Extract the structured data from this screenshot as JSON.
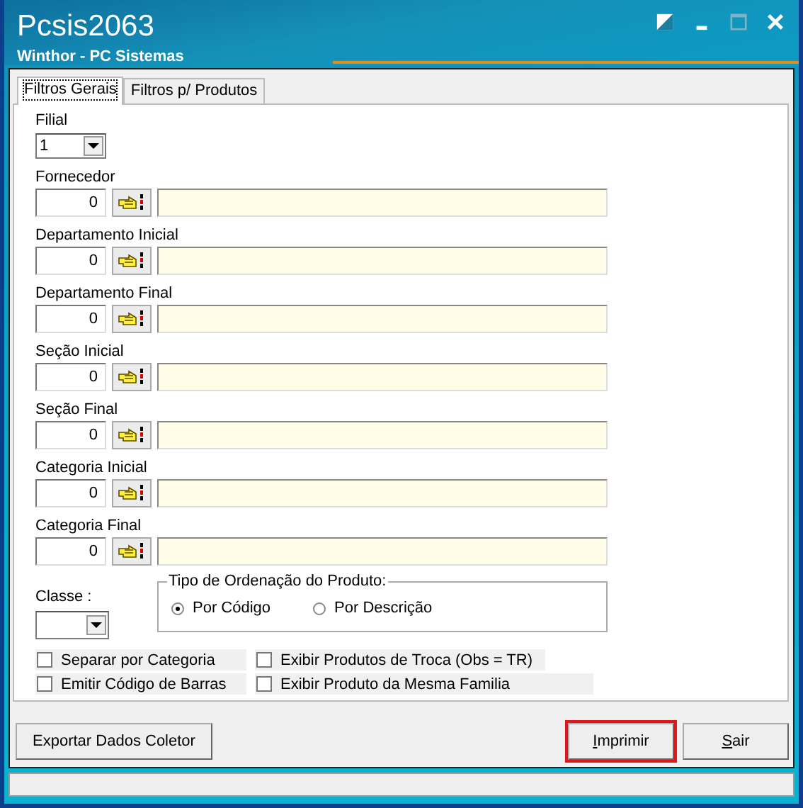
{
  "window": {
    "title": "Pcsis2063",
    "subtitle": "Winthor - PC Sistemas"
  },
  "tabs": [
    {
      "label": "Filtros Gerais",
      "selected": true
    },
    {
      "label": "Filtros p/ Produtos",
      "selected": false
    }
  ],
  "filial": {
    "label": "Filial",
    "value": "1"
  },
  "lookups": [
    {
      "label": "Fornecedor",
      "code": "0"
    },
    {
      "label": "Departamento Inicial",
      "code": "0"
    },
    {
      "label": "Departamento Final",
      "code": "0"
    },
    {
      "label": "Seção Inicial",
      "code": "0"
    },
    {
      "label": "Seção Final",
      "code": "0"
    },
    {
      "label": "Categoria Inicial",
      "code": "0"
    },
    {
      "label": "Categoria Final",
      "code": "0"
    }
  ],
  "classe": {
    "label": "Classe :"
  },
  "ordering": {
    "title": "Tipo de Ordenação do Produto:",
    "options": [
      {
        "label": "Por Código",
        "selected": true
      },
      {
        "label": "Por Descrição",
        "selected": false
      }
    ]
  },
  "checkboxes": [
    {
      "label": "Separar por Categoria",
      "checked": false
    },
    {
      "label": "Exibir Produtos de Troca (Obs = TR)",
      "checked": false
    },
    {
      "label": "Emitir Código de Barras",
      "checked": false
    },
    {
      "label": "Exibir Produto da Mesma Familia",
      "checked": false
    }
  ],
  "buttons": [
    {
      "label": "Exportar Dados Coletor",
      "highlighted": false
    },
    {
      "label": "Imprimir",
      "highlighted": true,
      "mnemonic": true
    },
    {
      "label": "Sair",
      "highlighted": false,
      "mnemonic": true
    }
  ]
}
